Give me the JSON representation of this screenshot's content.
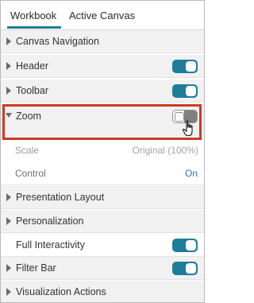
{
  "tabs": [
    {
      "label": "Workbook",
      "active": true
    },
    {
      "label": "Active Canvas",
      "active": false
    }
  ],
  "sections": {
    "canvas_navigation": {
      "label": "Canvas Navigation"
    },
    "header": {
      "label": "Header",
      "toggle": "on"
    },
    "toolbar": {
      "label": "Toolbar",
      "toggle": "on"
    },
    "zoom": {
      "label": "Zoom",
      "toggle": "off",
      "expanded": true
    },
    "scale": {
      "label": "Scale",
      "value": "Original (100%)"
    },
    "control": {
      "label": "Control",
      "value": "On"
    },
    "presentation_layout": {
      "label": "Presentation Layout"
    },
    "personalization": {
      "label": "Personalization"
    },
    "full_interactivity": {
      "label": "Full Interactivity",
      "toggle": "on"
    },
    "filter_bar": {
      "label": "Filter Bar",
      "toggle": "on"
    },
    "visualization_actions": {
      "label": "Visualization Actions"
    }
  },
  "colors": {
    "accent": "#1e7e9a",
    "highlight": "#cc3a24",
    "value_link": "#1e7e9a",
    "muted": "#a3a3a3"
  },
  "icons": [
    "caret-right-icon",
    "caret-down-icon",
    "hand-pointer-icon"
  ]
}
